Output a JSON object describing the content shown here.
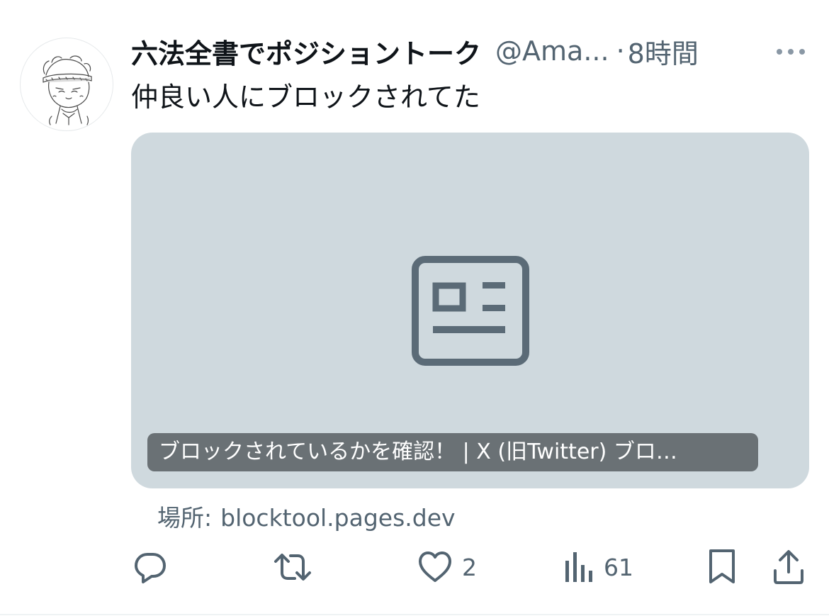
{
  "tweet": {
    "display_name": "六法全書でポジショントーク",
    "handle": "@Ama...",
    "separator": "·",
    "time": "8時間",
    "text": "仲良い人にブロックされてた"
  },
  "card": {
    "title": "ブロックされているかを確認！ | X (旧Twitter) ブロ…",
    "source_prefix": "場所:",
    "source_domain": "blocktool.pages.dev"
  },
  "actions": {
    "reply_count": "",
    "retweet_count": "",
    "like_count": "2",
    "views_count": "61"
  },
  "icons": {
    "more": "more-horizontal-icon",
    "article": "article-card-icon",
    "reply": "reply-icon",
    "retweet": "retweet-icon",
    "like": "heart-icon",
    "views": "views-chart-icon",
    "bookmark": "bookmark-icon",
    "share": "share-icon"
  },
  "colors": {
    "text_primary": "#0f1419",
    "text_secondary": "#536471",
    "card_background": "#cfd9de",
    "card_title_background": "#5c6266"
  }
}
